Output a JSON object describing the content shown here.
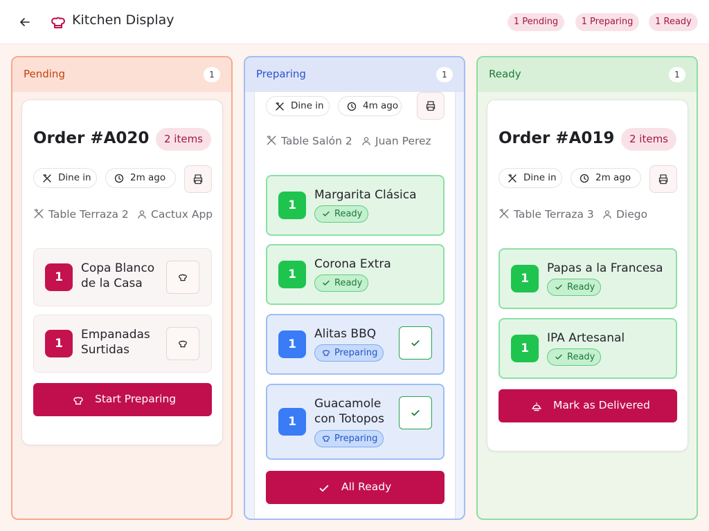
{
  "header": {
    "title": "Kitchen Display",
    "badges": {
      "pending": "1 Pending",
      "preparing": "1 Preparing",
      "ready": "1 Ready"
    }
  },
  "columns": {
    "pending": {
      "title": "Pending",
      "count": "1"
    },
    "preparing": {
      "title": "Preparing",
      "count": "1"
    },
    "ready": {
      "title": "Ready",
      "count": "1"
    }
  },
  "orders": {
    "a020": {
      "title": "Order #A020",
      "items_badge": "2 items",
      "service": "Dine in",
      "age": "2m ago",
      "table": "Table Terraza 2",
      "customer": "Cactux App",
      "items": [
        {
          "qty": "1",
          "name_line1": "Copa Blanco",
          "name_line2": "de la Casa"
        },
        {
          "qty": "1",
          "name_line1": "Empanadas",
          "name_line2": "Surtidas"
        }
      ],
      "action": "Start Preparing"
    },
    "preparing": {
      "service": "Dine in",
      "age": "4m ago",
      "table": "Table Salón 2",
      "customer": "Juan Perez",
      "items": [
        {
          "qty": "1",
          "name_line1": "Margarita Clásica",
          "status": "Ready"
        },
        {
          "qty": "1",
          "name_line1": "Corona Extra",
          "status": "Ready"
        },
        {
          "qty": "1",
          "name_line1": "Alitas BBQ",
          "status": "Preparing"
        },
        {
          "qty": "1",
          "name_line1": "Guacamole",
          "name_line2": "con Totopos",
          "status": "Preparing"
        }
      ],
      "action": "All Ready"
    },
    "a019": {
      "title": "Order #A019",
      "items_badge": "2 items",
      "service": "Dine in",
      "age": "2m ago",
      "table": "Table Terraza 3",
      "customer": "Diego",
      "items": [
        {
          "qty": "1",
          "name_line1": "Papas a la Francesa",
          "status": "Ready"
        },
        {
          "qty": "1",
          "name_line1": "IPA Artesanal",
          "status": "Ready"
        }
      ],
      "action": "Mark as Delivered"
    }
  },
  "colors": {
    "brand": "#c10f4e",
    "pending": "#c2410c",
    "preparing": "#2952cc",
    "ready": "#1d7a3a",
    "qty_ready": "#1ec44e",
    "qty_preparing": "#3a7bf6"
  },
  "icons": {
    "back": "arrow-left-icon",
    "app": "chef-hat-icon",
    "service": "utensils-crossed-icon",
    "age": "clock-icon",
    "print": "printer-icon",
    "customer": "user-icon",
    "check": "check-icon",
    "deliver": "cloche-icon"
  }
}
